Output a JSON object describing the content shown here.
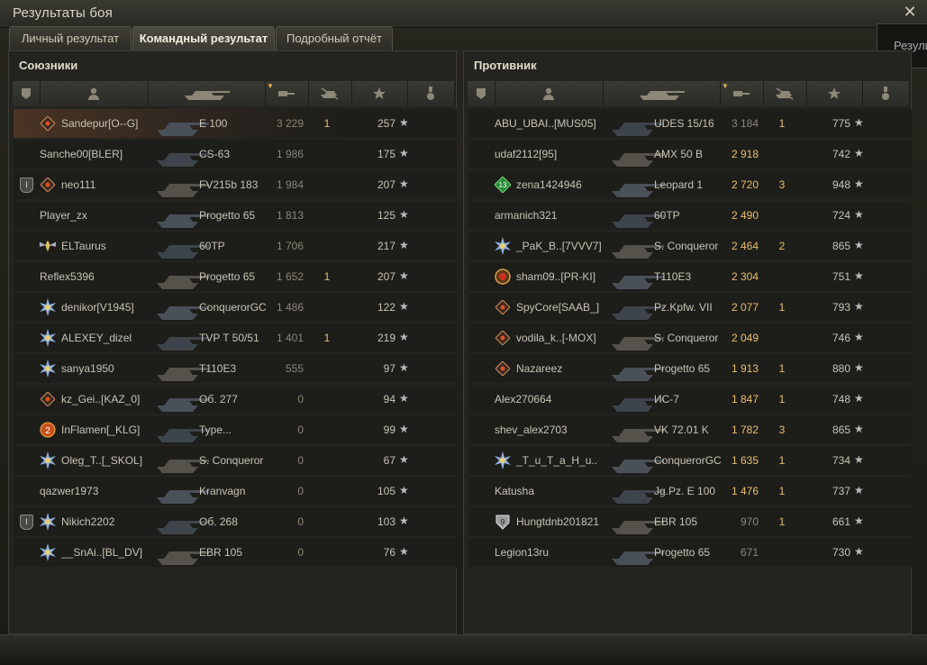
{
  "window": {
    "title": "Результаты боя",
    "side_tip": "Резуль"
  },
  "tabs": [
    {
      "label": "Личный результат",
      "active": false
    },
    {
      "label": "Командный результат",
      "active": true
    },
    {
      "label": "Подробный отчёт",
      "active": false
    }
  ],
  "columns": [
    "platoon-icon",
    "player-icon",
    "vehicle-icon",
    "damage-icon",
    "kills-icon",
    "xp-star-icon",
    "medal-icon"
  ],
  "colors": {
    "self_row": "#4a3424",
    "dmg_bright": "#e8c070",
    "dmg_dim": "#8a8678",
    "kills": "#e8c070"
  },
  "teams": [
    {
      "title": "Союзники",
      "rows": [
        {
          "name": "Sandepur[O--G]",
          "vehicle": "E 100",
          "damage": "3 229",
          "kills": "1",
          "xp": "257",
          "mark": "diamond",
          "self": true,
          "dim": true
        },
        {
          "name": "Sanche00[BLER]",
          "vehicle": "CS-63",
          "damage": "1 986",
          "kills": "",
          "xp": "175",
          "mark": "",
          "dim": true
        },
        {
          "name": "neo111",
          "vehicle": "FV215b 183",
          "damage": "1 984",
          "kills": "",
          "xp": "207",
          "mark": "diamond",
          "platoon": "I",
          "dim": true
        },
        {
          "name": "Player_zx",
          "vehicle": "Progetto 65",
          "damage": "1 813",
          "kills": "",
          "xp": "125",
          "mark": "",
          "dim": true
        },
        {
          "name": "ELTaurus",
          "vehicle": "60TP",
          "damage": "1 706",
          "kills": "",
          "xp": "217",
          "mark": "wings",
          "dim": true
        },
        {
          "name": "Reflex5396",
          "vehicle": "Progetto 65",
          "damage": "1 652",
          "kills": "1",
          "xp": "207",
          "mark": "",
          "dim": true
        },
        {
          "name": "denikor[V1945]",
          "vehicle": "ConquerorGC",
          "damage": "1 486",
          "kills": "",
          "xp": "122",
          "mark": "star",
          "dim": true
        },
        {
          "name": "ALEXEY_dizel",
          "vehicle": "TVP T 50/51",
          "damage": "1 401",
          "kills": "1",
          "xp": "219",
          "mark": "star",
          "dim": true
        },
        {
          "name": "sanya1950",
          "vehicle": "T110E3",
          "damage": "555",
          "kills": "",
          "xp": "97",
          "mark": "star",
          "dim": true
        },
        {
          "name": "kz_Gei..[KAZ_0]",
          "vehicle": "Об. 277",
          "damage": "0",
          "kills": "",
          "xp": "94",
          "mark": "diamond",
          "dim": true
        },
        {
          "name": "InFlamen[_KLG]",
          "vehicle": "Type...",
          "damage": "0",
          "kills": "",
          "xp": "99",
          "mark": "orange2",
          "dim": true
        },
        {
          "name": "Oleg_T..[_SKOL]",
          "vehicle": "S. Conqueror",
          "damage": "0",
          "kills": "",
          "xp": "67",
          "mark": "star",
          "dim": true
        },
        {
          "name": "qazwer1973",
          "vehicle": "Kranvagn",
          "damage": "0",
          "kills": "",
          "xp": "105",
          "mark": "",
          "dim": true
        },
        {
          "name": "Nikich2202",
          "vehicle": "Об. 268",
          "damage": "0",
          "kills": "",
          "xp": "103",
          "mark": "star",
          "platoon": "I",
          "dim": true
        },
        {
          "name": "__SnAi..[BL_DV]",
          "vehicle": "EBR 105",
          "damage": "0",
          "kills": "",
          "xp": "76",
          "mark": "star",
          "dim": true
        }
      ]
    },
    {
      "title": "Противник",
      "rows": [
        {
          "name": "ABU_UBAI..[MUS05]",
          "vehicle": "UDES 15/16",
          "damage": "3 184",
          "kills": "1",
          "xp": "775",
          "mark": "",
          "dim": true
        },
        {
          "name": "udaf2112[95]",
          "vehicle": "AMX 50 B",
          "damage": "2 918",
          "kills": "",
          "xp": "742",
          "mark": ""
        },
        {
          "name": "zena1424946",
          "vehicle": "Leopard 1",
          "damage": "2 720",
          "kills": "3",
          "xp": "948",
          "mark": "green13"
        },
        {
          "name": "armanich321",
          "vehicle": "60TP",
          "damage": "2 490",
          "kills": "",
          "xp": "724",
          "mark": ""
        },
        {
          "name": "_PaK_B..[7VVV7]",
          "vehicle": "S. Conqueror",
          "damage": "2 464",
          "kills": "2",
          "xp": "865",
          "mark": "star"
        },
        {
          "name": "sham09..[PR-KI]",
          "vehicle": "T110E3",
          "damage": "2 304",
          "kills": "",
          "xp": "751",
          "mark": "ring"
        },
        {
          "name": "SpyCore[SAAB_]",
          "vehicle": "Pz.Kpfw. VII",
          "damage": "2 077",
          "kills": "1",
          "xp": "793",
          "mark": "diamond"
        },
        {
          "name": "vodila_k..[-MOX]",
          "vehicle": "S. Conqueror",
          "damage": "2 049",
          "kills": "",
          "xp": "746",
          "mark": "diamond"
        },
        {
          "name": "Nazareez",
          "vehicle": "Progetto 65",
          "damage": "1 913",
          "kills": "1",
          "xp": "880",
          "mark": "diamond"
        },
        {
          "name": "Alex270664",
          "vehicle": "ИС-7",
          "damage": "1 847",
          "kills": "1",
          "xp": "748",
          "mark": ""
        },
        {
          "name": "shev_alex2703",
          "vehicle": "VK 72.01 K",
          "damage": "1 782",
          "kills": "3",
          "xp": "865",
          "mark": ""
        },
        {
          "name": "_T_u_T_a_H_u..",
          "vehicle": "ConquerorGC",
          "damage": "1 635",
          "kills": "1",
          "xp": "734",
          "mark": "star"
        },
        {
          "name": "Katusha",
          "vehicle": "Jg.Pz. E 100",
          "damage": "1 476",
          "kills": "1",
          "xp": "737",
          "mark": ""
        },
        {
          "name": "Hungtdnb201821",
          "vehicle": "EBR 105",
          "damage": "970",
          "kills": "1",
          "xp": "661",
          "mark": "shield9",
          "dim": true
        },
        {
          "name": "Legion13ru",
          "vehicle": "Progetto 65",
          "damage": "671",
          "kills": "",
          "xp": "730",
          "mark": "",
          "dim": true
        }
      ]
    }
  ]
}
